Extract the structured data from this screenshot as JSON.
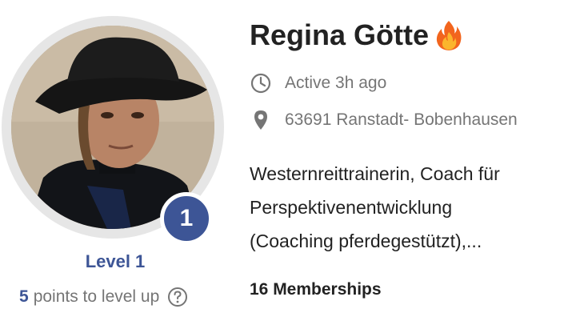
{
  "profile": {
    "name": "Regina Götte",
    "status_icon": "fire-emoji",
    "active": "Active 3h ago",
    "location": "63691 Ranstadt- Bobenhausen",
    "bio_lines": [
      "Westernreittrainerin, Coach für",
      "Perspektivenentwicklung",
      "(Coaching pferdegestützt),..."
    ],
    "memberships": "16 Memberships"
  },
  "level": {
    "badge": "1",
    "label": "Level 1",
    "points": "5",
    "points_text": "points to level up"
  },
  "colors": {
    "accent": "#3d5596",
    "muted_text": "#757575",
    "primary_text": "#222222",
    "avatar_ring": "#e6e6e6"
  }
}
